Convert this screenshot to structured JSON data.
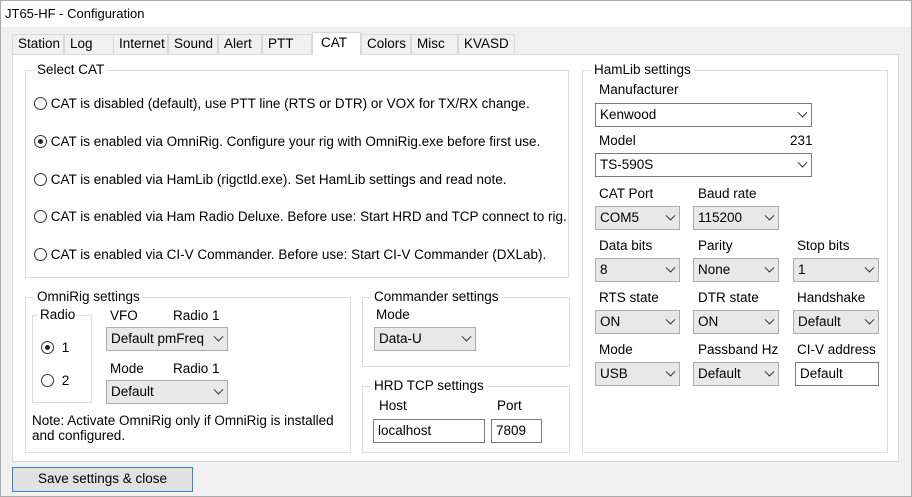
{
  "window": {
    "title": "JT65-HF - Configuration"
  },
  "tabs": [
    {
      "label": "Station"
    },
    {
      "label": "Log"
    },
    {
      "label": "Internet"
    },
    {
      "label": "Sound"
    },
    {
      "label": "Alert"
    },
    {
      "label": "PTT"
    },
    {
      "label": "CAT"
    },
    {
      "label": "Colors"
    },
    {
      "label": "Misc"
    },
    {
      "label": "KVASD"
    }
  ],
  "active_tab": "CAT",
  "select_cat": {
    "title": "Select CAT",
    "options": [
      {
        "label": "CAT is disabled (default), use PTT line (RTS or DTR) or VOX for TX/RX change.",
        "selected": false
      },
      {
        "label": "CAT is enabled via OmniRig. Configure your rig with OmniRig.exe before first use.",
        "selected": true
      },
      {
        "label": "CAT is enabled via HamLib (rigctld.exe). Set HamLib settings and read note.",
        "selected": false
      },
      {
        "label": "CAT is enabled via Ham Radio Deluxe. Before use: Start HRD and TCP connect to rig.",
        "selected": false
      },
      {
        "label": "CAT is enabled via CI-V Commander. Before use: Start CI-V Commander (DXLab).",
        "selected": false
      }
    ]
  },
  "omnirig": {
    "title": "OmniRig settings",
    "radio_group_title": "Radio",
    "radio_options": [
      {
        "label": "1",
        "selected": true
      },
      {
        "label": "2",
        "selected": false
      }
    ],
    "vfo_label": "VFO",
    "vfo_radio_label": "Radio 1",
    "vfo_value": "Default pmFreq",
    "mode_label": "Mode",
    "mode_radio_label": "Radio 1",
    "mode_value": "Default",
    "note": "Note: Activate OmniRig only if OmniRig is installed and configured."
  },
  "commander": {
    "title": "Commander settings",
    "mode_label": "Mode",
    "mode_value": "Data-U"
  },
  "hrd": {
    "title": "HRD TCP settings",
    "host_label": "Host",
    "host_value": "localhost",
    "port_label": "Port",
    "port_value": "7809"
  },
  "hamlib": {
    "title": "HamLib settings",
    "manufacturer_label": "Manufacturer",
    "manufacturer_value": "Kenwood",
    "model_label": "Model",
    "model_number": "231",
    "model_value": "TS-590S",
    "cat_port_label": "CAT Port",
    "cat_port_value": "COM5",
    "baud_rate_label": "Baud rate",
    "baud_rate_value": "115200",
    "data_bits_label": "Data bits",
    "data_bits_value": "8",
    "parity_label": "Parity",
    "parity_value": "None",
    "stop_bits_label": "Stop bits",
    "stop_bits_value": "1",
    "rts_label": "RTS state",
    "rts_value": "ON",
    "dtr_label": "DTR state",
    "dtr_value": "ON",
    "handshake_label": "Handshake",
    "handshake_value": "Default",
    "mode_label": "Mode",
    "mode_value": "USB",
    "passband_label": "Passband Hz",
    "passband_value": "Default",
    "civ_label": "CI-V address",
    "civ_value": "Default"
  },
  "footer": {
    "save_label": "Save settings & close"
  },
  "colors": {
    "focus_border": "#3b7fd6",
    "window_bg": "#f0f0f0",
    "page_bg": "#ffffff"
  }
}
